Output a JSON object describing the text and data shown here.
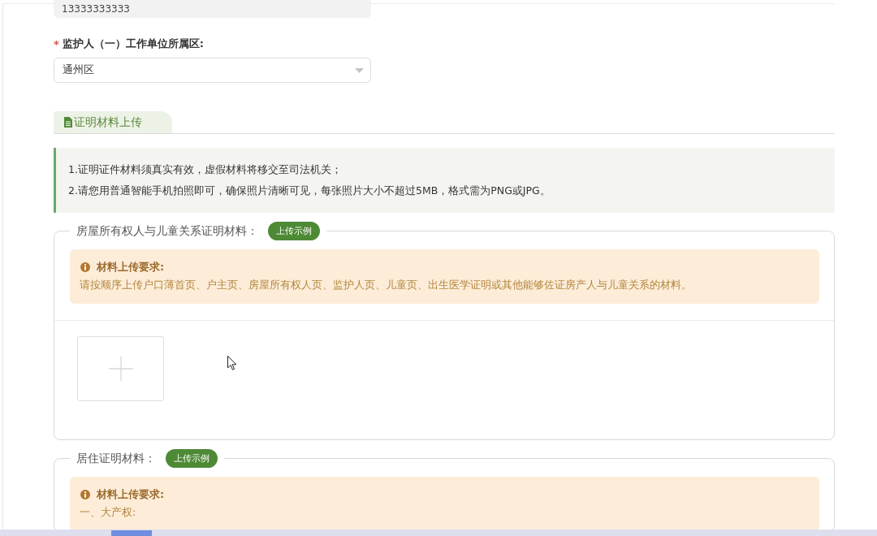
{
  "phone_field": {
    "value": "13333333333"
  },
  "district_field": {
    "required_mark": "*",
    "label": "监护人（一）工作单位所属区:",
    "value": "通州区"
  },
  "tabs": [
    {
      "label": "证明材料上传",
      "selected": true
    }
  ],
  "notice": {
    "lines": [
      "1.证明证件材料须真实有效，虚假材料将移交至司法机关；",
      "2.请您用普通智能手机拍照即可，确保照片清晰可见，每张照片大小不超过5MB，格式需为PNG或JPG。"
    ]
  },
  "sections": [
    {
      "legend": "房屋所有权人与儿童关系证明材料：",
      "example_button": "上传示例",
      "requirements": {
        "title": "材料上传要求:",
        "lines": [
          "请按顺序上传户口薄首页、户主页、房屋所有权人页、监护人页、儿童页、出生医学证明或其他能够佐证房产人与儿童关系的材料。"
        ]
      },
      "upload_box": true
    },
    {
      "legend": "居住证明材料：",
      "example_button": "上传示例",
      "requirements": {
        "title": "材料上传要求:",
        "lines": [
          "一、大产权:"
        ]
      }
    }
  ]
}
